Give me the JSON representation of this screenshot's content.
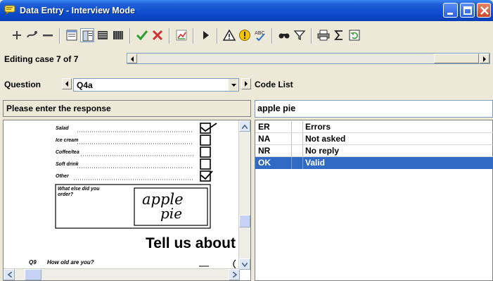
{
  "window": {
    "title": "Data Entry - Interview Mode"
  },
  "status": {
    "editing_case": "Editing case 7 of 7"
  },
  "question": {
    "label": "Question",
    "selected": "Q4a",
    "prompt": "Please enter the response"
  },
  "code_list": {
    "label": "Code List",
    "response_value": "apple pie",
    "rows": [
      {
        "code": "ER",
        "desc": "Errors",
        "selected": false
      },
      {
        "code": "NA",
        "desc": "Not asked",
        "selected": false
      },
      {
        "code": "NR",
        "desc": "No reply",
        "selected": false
      },
      {
        "code": "OK",
        "desc": "Valid",
        "selected": true
      }
    ],
    "selection_color": "#316ac5"
  },
  "form_image": {
    "items": [
      "Salad",
      "Ice cream",
      "Coffee/tea",
      "Soft drink",
      "Other"
    ],
    "checked": [
      true,
      false,
      false,
      false,
      true
    ],
    "other_prompt_line1": "What else did you",
    "other_prompt_line2": "order?",
    "handwriting_line1": "apple",
    "handwriting_line2": "pie",
    "heading": "Tell us about",
    "q9_number": "Q9",
    "q9_text": "How old are you?"
  },
  "colors": {
    "titlebar": "#0a49c9",
    "face": "#ece9d8"
  }
}
